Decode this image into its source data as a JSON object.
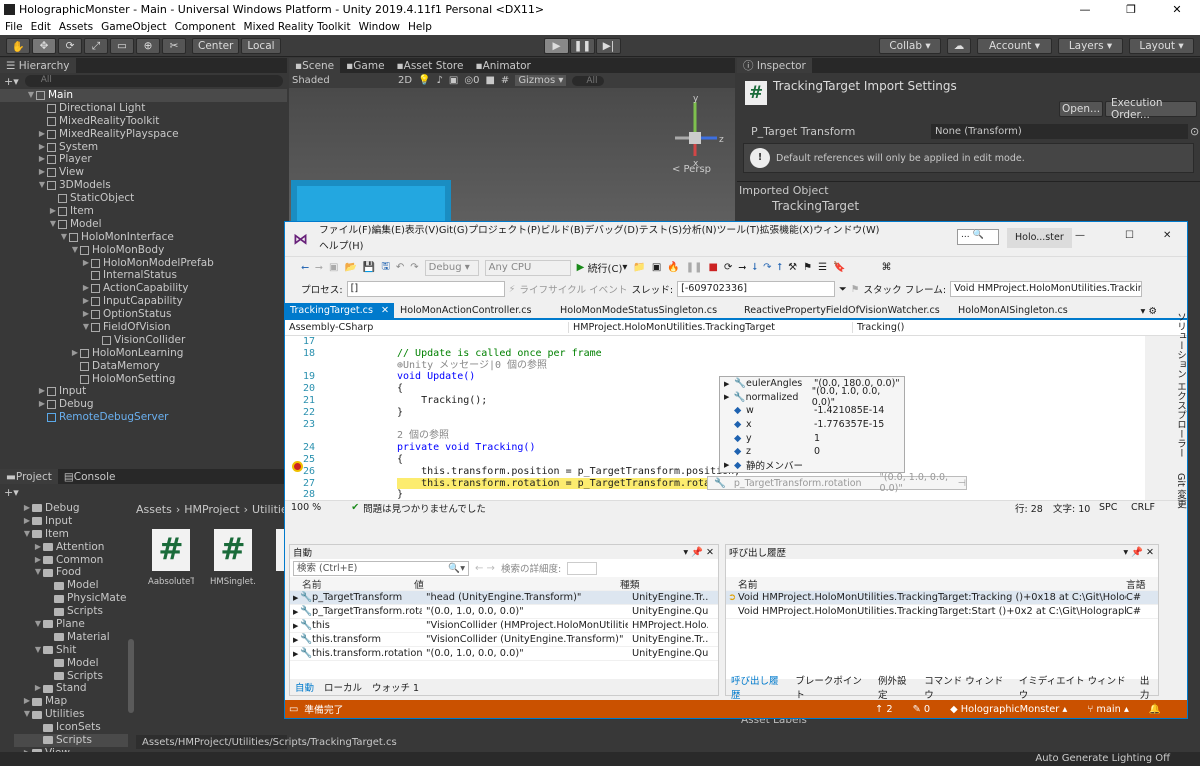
{
  "unity": {
    "title": "HolographicMonster - Main - Universal Windows Platform - Unity 2019.4.11f1 Personal <DX11>",
    "menu": [
      "File",
      "Edit",
      "Assets",
      "GameObject",
      "Component",
      "Mixed Reality Toolkit",
      "Window",
      "Help"
    ],
    "toolbar": {
      "center": "Center",
      "local": "Local",
      "collab": "Collab",
      "account": "Account",
      "layers": "Layers",
      "layout": "Layout"
    },
    "hierarchy": {
      "tab": "Hierarchy",
      "search": "All",
      "items": [
        {
          "label": "Main",
          "depth": 0,
          "tri": "▼",
          "type": "scene"
        },
        {
          "label": "Directional Light",
          "depth": 1,
          "tri": "",
          "type": "cube"
        },
        {
          "label": "MixedRealityToolkit",
          "depth": 1,
          "tri": "",
          "type": "cube"
        },
        {
          "label": "MixedRealityPlayspace",
          "depth": 1,
          "tri": "▶",
          "type": "cube"
        },
        {
          "label": "System",
          "depth": 1,
          "tri": "▶",
          "type": "cube"
        },
        {
          "label": "Player",
          "depth": 1,
          "tri": "▶",
          "type": "cube"
        },
        {
          "label": "View",
          "depth": 1,
          "tri": "▶",
          "type": "cube"
        },
        {
          "label": "3DModels",
          "depth": 1,
          "tri": "▼",
          "type": "cube"
        },
        {
          "label": "StaticObject",
          "depth": 2,
          "tri": "",
          "type": "cube"
        },
        {
          "label": "Item",
          "depth": 2,
          "tri": "▶",
          "type": "cube"
        },
        {
          "label": "Model",
          "depth": 2,
          "tri": "▼",
          "type": "cube"
        },
        {
          "label": "HoloMonInterface",
          "depth": 3,
          "tri": "▼",
          "type": "cube"
        },
        {
          "label": "HoloMonBody",
          "depth": 4,
          "tri": "▼",
          "type": "cube"
        },
        {
          "label": "HoloMonModelPrefab",
          "depth": 5,
          "tri": "▶",
          "type": "cube"
        },
        {
          "label": "InternalStatus",
          "depth": 5,
          "tri": "",
          "type": "cube"
        },
        {
          "label": "ActionCapability",
          "depth": 5,
          "tri": "▶",
          "type": "cube"
        },
        {
          "label": "InputCapability",
          "depth": 5,
          "tri": "▶",
          "type": "cube"
        },
        {
          "label": "OptionStatus",
          "depth": 5,
          "tri": "▶",
          "type": "cube"
        },
        {
          "label": "FieldOfVision",
          "depth": 5,
          "tri": "▼",
          "type": "cube"
        },
        {
          "label": "VisionCollider",
          "depth": 6,
          "tri": "",
          "type": "cube"
        },
        {
          "label": "HoloMonLearning",
          "depth": 4,
          "tri": "▶",
          "type": "cube"
        },
        {
          "label": "DataMemory",
          "depth": 4,
          "tri": "",
          "type": "cube"
        },
        {
          "label": "HoloMonSetting",
          "depth": 4,
          "tri": "",
          "type": "cube"
        },
        {
          "label": "Input",
          "depth": 1,
          "tri": "▶",
          "type": "cube"
        },
        {
          "label": "Debug",
          "depth": 1,
          "tri": "▶",
          "type": "cube"
        },
        {
          "label": "RemoteDebugServer",
          "depth": 1,
          "tri": "",
          "type": "bluecube"
        }
      ]
    },
    "scene": {
      "tabs": [
        "Scene",
        "Game",
        "Asset Store",
        "Animator"
      ],
      "shaded": "Shaded",
      "mode2d": "2D",
      "layers_count": "0",
      "gizmos": "Gizmos",
      "search": "All",
      "persp": "Persp",
      "axes": {
        "x": "x",
        "y": "y",
        "z": "z"
      }
    },
    "inspector": {
      "tab": "Inspector",
      "title": "TrackingTarget Import Settings",
      "open": "Open...",
      "exec": "Execution Order...",
      "field_label": "P_Target Transform",
      "field_value": "None (Transform)",
      "info": "Default references will only be applied in edit mode.",
      "imported": "Imported Object",
      "imported_name": "TrackingTarget",
      "asset_labels": "Asset Labels"
    },
    "project": {
      "tabs": [
        "Project",
        "Console"
      ],
      "breadcrumb": [
        "Assets",
        "HMProject",
        "Utilities"
      ],
      "tree": [
        {
          "label": "Debug",
          "depth": 1,
          "tri": "▶"
        },
        {
          "label": "Input",
          "depth": 1,
          "tri": "▶"
        },
        {
          "label": "Item",
          "depth": 1,
          "tri": "▼"
        },
        {
          "label": "Attention",
          "depth": 2,
          "tri": "▶"
        },
        {
          "label": "Common",
          "depth": 2,
          "tri": "▶"
        },
        {
          "label": "Food",
          "depth": 2,
          "tri": "▼"
        },
        {
          "label": "Model",
          "depth": 3,
          "tri": ""
        },
        {
          "label": "PhysicMate",
          "depth": 3,
          "tri": ""
        },
        {
          "label": "Scripts",
          "depth": 3,
          "tri": ""
        },
        {
          "label": "Plane",
          "depth": 2,
          "tri": "▼"
        },
        {
          "label": "Material",
          "depth": 3,
          "tri": ""
        },
        {
          "label": "Shit",
          "depth": 2,
          "tri": "▼"
        },
        {
          "label": "Model",
          "depth": 3,
          "tri": ""
        },
        {
          "label": "Scripts",
          "depth": 3,
          "tri": ""
        },
        {
          "label": "Stand",
          "depth": 2,
          "tri": "▶"
        },
        {
          "label": "Map",
          "depth": 1,
          "tri": "▶"
        },
        {
          "label": "Utilities",
          "depth": 1,
          "tri": "▼"
        },
        {
          "label": "IconSets",
          "depth": 2,
          "tri": ""
        },
        {
          "label": "Scripts",
          "depth": 2,
          "tri": ""
        },
        {
          "label": "View",
          "depth": 1,
          "tri": "▶"
        }
      ],
      "assets": [
        "AabsoluteT...",
        "HMSinglet...",
        "Hol"
      ],
      "path": "Assets/HMProject/Utilities/Scripts/TrackingTarget.cs"
    },
    "footer": "Auto Generate Lighting Off"
  },
  "vs": {
    "menu": [
      "ファイル(F)",
      "編集(E)",
      "表示(V)",
      "Git(G)",
      "プロジェクト(P)",
      "ビルド(B)",
      "デバッグ(D)",
      "テスト(S)",
      "分析(N)",
      "ツール(T)",
      "拡張機能(X)",
      "ウィンドウ(W)"
    ],
    "menu2": "ヘルプ(H)",
    "title": "Holo...ster",
    "toolbar": {
      "config": "Debug",
      "platform": "Any CPU",
      "continue": "続行(C)"
    },
    "process_label": "プロセス:",
    "process_value": "[]",
    "lifecycle": "ライフサイクル イベント",
    "thread_label": "スレッド:",
    "thread_value": "[-609702336]",
    "stack_label": "スタック フレーム:",
    "stack_value": "Void HMProject.HoloMonUtilities.Tracking",
    "tabs": [
      "TrackingTarget.cs",
      "HoloMonActionController.cs",
      "HoloMonModeStatusSingleton.cs",
      "ReactivePropertyFieldOfVisionWatcher.cs",
      "HoloMonAISingleton.cs"
    ],
    "nav": {
      "project": "Assembly-CSharp",
      "class": "HMProject.HoloMonUtilities.TrackingTarget",
      "member": "Tracking()"
    },
    "code": [
      {
        "n": "17",
        "t": ""
      },
      {
        "n": "18",
        "t": "// Update is called once per frame",
        "c": "cmt"
      },
      {
        "n": "",
        "t": "⊕Unity メッセージ|0 個の参照",
        "c": "gray"
      },
      {
        "n": "19",
        "t": "void Update()",
        "c": "kw"
      },
      {
        "n": "20",
        "t": "{"
      },
      {
        "n": "21",
        "t": "    Tracking();"
      },
      {
        "n": "22",
        "t": "}"
      },
      {
        "n": "23",
        "t": ""
      },
      {
        "n": "",
        "t": "2 個の参照",
        "c": "gray"
      },
      {
        "n": "24",
        "t": "private void Tracking()",
        "c": "kw"
      },
      {
        "n": "25",
        "t": "{"
      },
      {
        "n": "26",
        "t": "    this.transform.position = p_TargetTransform.position;"
      },
      {
        "n": "27",
        "t": "    this.transform.rotation = p_TargetTransform.rotation;",
        "hl": true
      },
      {
        "n": "28",
        "t": "}"
      }
    ],
    "tooltip": [
      {
        "k": "eulerAngles",
        "v": "\"(0.0, 180.0, 0.0)\""
      },
      {
        "k": "normalized",
        "v": "\"(0.0, 1.0, 0.0, 0.0)\""
      },
      {
        "k": "w",
        "v": "-1.421085E-14"
      },
      {
        "k": "x",
        "v": "-1.776357E-15"
      },
      {
        "k": "y",
        "v": "1"
      },
      {
        "k": "z",
        "v": "0"
      },
      {
        "k": "静的メンバー",
        "v": ""
      }
    ],
    "tooltip_bottom": {
      "k": "p_TargetTransform.rotation",
      "v": "\"(0.0, 1.0, 0.0, 0.0)\""
    },
    "editor_status": {
      "zoom": "100 %",
      "issues": "問題は見つかりませんでした",
      "line": "行: 28",
      "col": "文字: 10",
      "spc": "SPC",
      "crlf": "CRLF"
    },
    "autos": {
      "title": "自動",
      "search": "検索 (Ctrl+E)",
      "depth": "検索の詳細度:",
      "cols": [
        "名前",
        "値",
        "種類"
      ],
      "rows": [
        {
          "name": "p_TargetTransform",
          "value": "\"head (UnityEngine.Transform)\"",
          "type": "UnityEngine.Tr..."
        },
        {
          "name": "p_TargetTransform.rotat...",
          "value": "\"(0.0, 1.0, 0.0, 0.0)\"",
          "type": "UnityEngine.Qu..."
        },
        {
          "name": "this",
          "value": "\"VisionCollider (HMProject.HoloMonUtilities.Tr...",
          "type": "HMProject.Holo..."
        },
        {
          "name": "this.transform",
          "value": "\"VisionCollider (UnityEngine.Transform)\"",
          "type": "UnityEngine.Tr..."
        },
        {
          "name": "this.transform.rotation",
          "value": "\"(0.0, 1.0, 0.0, 0.0)\"",
          "type": "UnityEngine.Qu..."
        }
      ],
      "tabs": [
        "自動",
        "ローカル",
        "ウォッチ 1"
      ]
    },
    "callstack": {
      "title": "呼び出し履歴",
      "cols": [
        "名前",
        "言語"
      ],
      "rows": [
        {
          "name": "Void HMProject.HoloMonUtilities.TrackingTarget:Tracking ()+0x18 at C:\\Git\\HolographicM...",
          "lang": "C#"
        },
        {
          "name": "Void HMProject.HoloMonUtilities.TrackingTarget:Start ()+0x2 at C:\\Git\\HolographicMonst...",
          "lang": "C#"
        }
      ],
      "tabs": [
        "呼び出し履歴",
        "ブレークポイント",
        "例外設定",
        "コマンド ウィンドウ",
        "イミディエイト ウィンドウ",
        "出力"
      ]
    },
    "statusbar": {
      "ready": "準備完了",
      "up": "2",
      "pencil": "0",
      "repo": "HolographicMonster",
      "branch": "main"
    },
    "side": [
      "ソリューション エクスプローラー",
      "Git 変更"
    ]
  }
}
